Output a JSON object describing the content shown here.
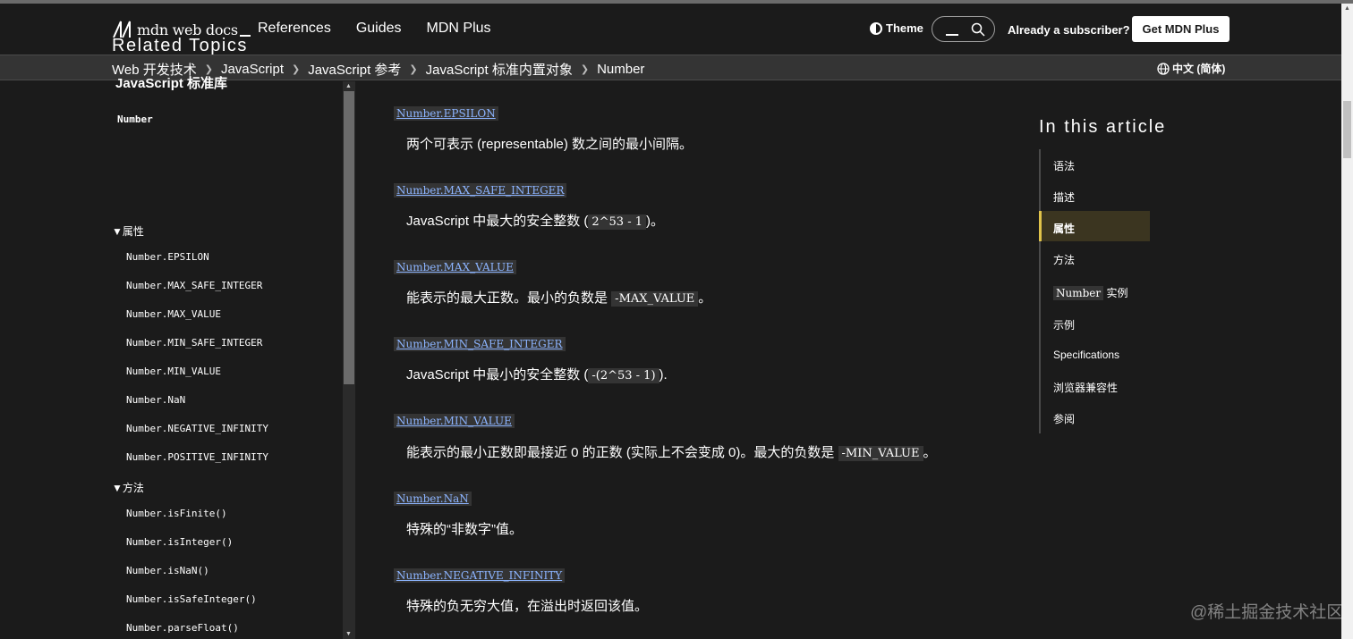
{
  "header": {
    "logo_text": "mdn web docs",
    "nav": [
      "References",
      "Guides",
      "MDN Plus"
    ],
    "theme_label": "Theme",
    "subscriber_label": "Already a subscriber?",
    "get_plus_label": "Get MDN Plus"
  },
  "breadcrumb": {
    "items": [
      "Web 开发技术",
      "JavaScript",
      "JavaScript 参考",
      "JavaScript 标准内置对象",
      "Number"
    ],
    "language": "中文 (简体)"
  },
  "sidebar": {
    "title": "Related Topics",
    "library": "JavaScript 标准库",
    "current": "Number",
    "sections": [
      {
        "label": "▼属性",
        "links": [
          "Number.EPSILON",
          "Number.MAX_SAFE_INTEGER",
          "Number.MAX_VALUE",
          "Number.MIN_SAFE_INTEGER",
          "Number.MIN_VALUE",
          "Number.NaN",
          "Number.NEGATIVE_INFINITY",
          "Number.POSITIVE_INFINITY"
        ]
      },
      {
        "label": "▼方法",
        "links": [
          "Number.isFinite()",
          "Number.isInteger()",
          "Number.isNaN()",
          "Number.isSafeInteger()",
          "Number.parseFloat()"
        ]
      }
    ]
  },
  "main": {
    "properties": [
      {
        "name": "Number.EPSILON",
        "desc": "两个可表示 (representable) 数之间的最小间隔。"
      },
      {
        "name": "Number.MAX_SAFE_INTEGER",
        "desc_before": "JavaScript 中最大的安全整数 (",
        "code": "2^53 - 1",
        "desc_after": ")。"
      },
      {
        "name": "Number.MAX_VALUE",
        "desc_before": "能表示的最大正数。最小的负数是 ",
        "code": "-MAX_VALUE",
        "desc_after": "。"
      },
      {
        "name": "Number.MIN_SAFE_INTEGER",
        "desc_before": "JavaScript 中最小的安全整数 (",
        "code": "-(2^53 - 1)",
        "desc_after": ")."
      },
      {
        "name": "Number.MIN_VALUE",
        "desc_before": "能表示的最小正数即最接近 0 的正数 (实际上不会变成 0)。最大的负数是 ",
        "code": "-MIN_VALUE",
        "desc_after": "。"
      },
      {
        "name": "Number.NaN",
        "desc": "特殊的“非数字”值。"
      },
      {
        "name": "Number.NEGATIVE_INFINITY",
        "desc": "特殊的负无穷大值，在溢出时返回该值。"
      }
    ]
  },
  "toc": {
    "title": "In this article",
    "items": [
      "语法",
      "描述",
      "属性",
      "方法",
      "实例",
      "示例",
      "Specifications",
      "浏览器兼容性",
      "参阅"
    ],
    "instance_code": "Number",
    "active_index": 2
  },
  "watermark": "@稀土掘金技术社区",
  "colors": {
    "background": "#1b1b1b",
    "link": "#8cb4ff",
    "toc_active": "#e0c34a"
  }
}
